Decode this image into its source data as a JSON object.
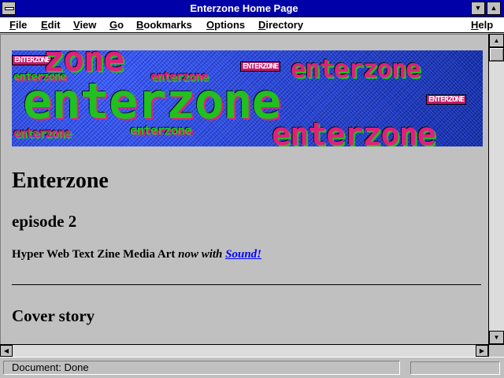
{
  "window": {
    "title": "Enterzone Home Page"
  },
  "menu": {
    "items": [
      "File",
      "Edit",
      "View",
      "Go",
      "Bookmarks",
      "Options",
      "Directory"
    ],
    "help": "Help"
  },
  "banner": {
    "small_label": "enterzone",
    "big_text": "enterzone",
    "top_text": "zone",
    "badge_text": "ENTERZONE"
  },
  "page": {
    "title": "Enterzone",
    "episode": "episode 2",
    "tagline_plain": "Hyper Web Text Zine Media Art ",
    "tagline_em": "now with",
    "tagline_link": "Sound!",
    "section_heading": "Cover story"
  },
  "status": {
    "text": "Document: Done"
  },
  "icons": {
    "system_menu": "system-menu-icon",
    "minimize": "minimize-icon",
    "maximize": "maximize-icon",
    "scroll_up": "arrow-up-icon",
    "scroll_down": "arrow-down-icon",
    "scroll_left": "arrow-left-icon",
    "scroll_right": "arrow-right-icon"
  },
  "colors": {
    "titlebar": "#0000a8",
    "link": "#0000ff",
    "banner_bg": "#2040c8",
    "banner_pink": "#e0207c",
    "banner_green": "#20c020"
  }
}
